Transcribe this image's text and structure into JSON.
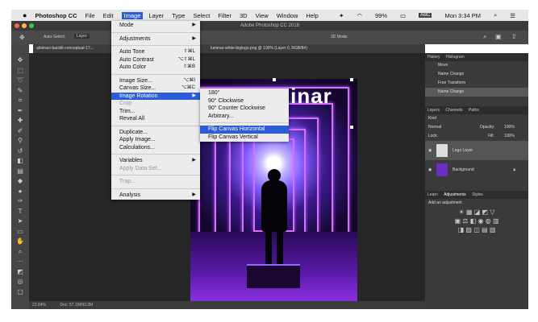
{
  "mac_menu": {
    "apple": "",
    "app": "Photoshop CC",
    "items": [
      "File",
      "Edit",
      "Image",
      "Layer",
      "Type",
      "Select",
      "Filter",
      "3D",
      "View",
      "Window",
      "Help"
    ],
    "active": "Image",
    "status": {
      "battery": "99%",
      "abc": "ABC",
      "clock": "Mon 3:34 PM"
    }
  },
  "window_title": "Adobe Photoshop CC 2018",
  "options": {
    "auto_select": "Auto-Select:",
    "layer": "Layer",
    "mode_3d": "3D Mode:"
  },
  "doc_tabs": [
    "abstract-backlit-conceptual-17...",
    "luminar-white-biglogo.png @ 100% (Layer 0, RGB/8#)"
  ],
  "canvas_text": "minar",
  "status_bar": {
    "zoom": "22.64%",
    "doc": "Doc: 57.1M/93.2M"
  },
  "image_menu": {
    "items": [
      {
        "label": "Mode",
        "shortcut": "",
        "submenu": true,
        "disabled": false
      },
      {
        "sep": true
      },
      {
        "label": "Adjustments",
        "shortcut": "",
        "submenu": true,
        "disabled": false
      },
      {
        "sep": true
      },
      {
        "label": "Auto Tone",
        "shortcut": "⇧⌘L",
        "submenu": false,
        "disabled": false
      },
      {
        "label": "Auto Contrast",
        "shortcut": "⌥⇧⌘L",
        "submenu": false,
        "disabled": false
      },
      {
        "label": "Auto Color",
        "shortcut": "⇧⌘B",
        "submenu": false,
        "disabled": false
      },
      {
        "sep": true
      },
      {
        "label": "Image Size...",
        "shortcut": "⌥⌘I",
        "submenu": false,
        "disabled": false
      },
      {
        "label": "Canvas Size...",
        "shortcut": "⌥⌘C",
        "submenu": false,
        "disabled": false
      },
      {
        "label": "Image Rotation",
        "shortcut": "",
        "submenu": true,
        "disabled": false,
        "highlight": true
      },
      {
        "label": "Crop",
        "shortcut": "",
        "submenu": false,
        "disabled": true
      },
      {
        "label": "Trim...",
        "shortcut": "",
        "submenu": false,
        "disabled": false
      },
      {
        "label": "Reveal All",
        "shortcut": "",
        "submenu": false,
        "disabled": false
      },
      {
        "sep": true
      },
      {
        "label": "Duplicate...",
        "shortcut": "",
        "submenu": false,
        "disabled": false
      },
      {
        "label": "Apply Image...",
        "shortcut": "",
        "submenu": false,
        "disabled": false
      },
      {
        "label": "Calculations...",
        "shortcut": "",
        "submenu": false,
        "disabled": false
      },
      {
        "sep": true
      },
      {
        "label": "Variables",
        "shortcut": "",
        "submenu": true,
        "disabled": false
      },
      {
        "label": "Apply Data Set...",
        "shortcut": "",
        "submenu": false,
        "disabled": true
      },
      {
        "sep": true
      },
      {
        "label": "Trap...",
        "shortcut": "",
        "submenu": false,
        "disabled": true
      },
      {
        "sep": true
      },
      {
        "label": "Analysis",
        "shortcut": "",
        "submenu": true,
        "disabled": false
      }
    ]
  },
  "rotation_menu": {
    "items": [
      {
        "label": "180°"
      },
      {
        "label": "90° Clockwise"
      },
      {
        "label": "90° Counter Clockwise"
      },
      {
        "label": "Arbitrary..."
      },
      {
        "sep": true
      },
      {
        "label": "Flip Canvas Horizontal",
        "highlight": true
      },
      {
        "label": "Flip Canvas Vertical"
      }
    ]
  },
  "history_panel": {
    "tabs": [
      "History",
      "Histogram"
    ],
    "items": [
      "Move",
      "Name Change",
      "Free Transform",
      "Name Change"
    ]
  },
  "layers_panel": {
    "tabs": [
      "Layers",
      "Channels",
      "Paths"
    ],
    "kind": "Kind",
    "blend": "Normal",
    "opacity_label": "Opacity:",
    "opacity": "100%",
    "lock": "Lock:",
    "fill_label": "Fill:",
    "fill": "100%",
    "layers": [
      "Logo Layer",
      "Background"
    ]
  },
  "adjust_panel": {
    "tabs": [
      "Learn",
      "Adjustments",
      "Styles"
    ],
    "add": "Add an adjustment"
  },
  "colors": {
    "accent": "#2b5ed6",
    "neon": "#d96dff"
  }
}
